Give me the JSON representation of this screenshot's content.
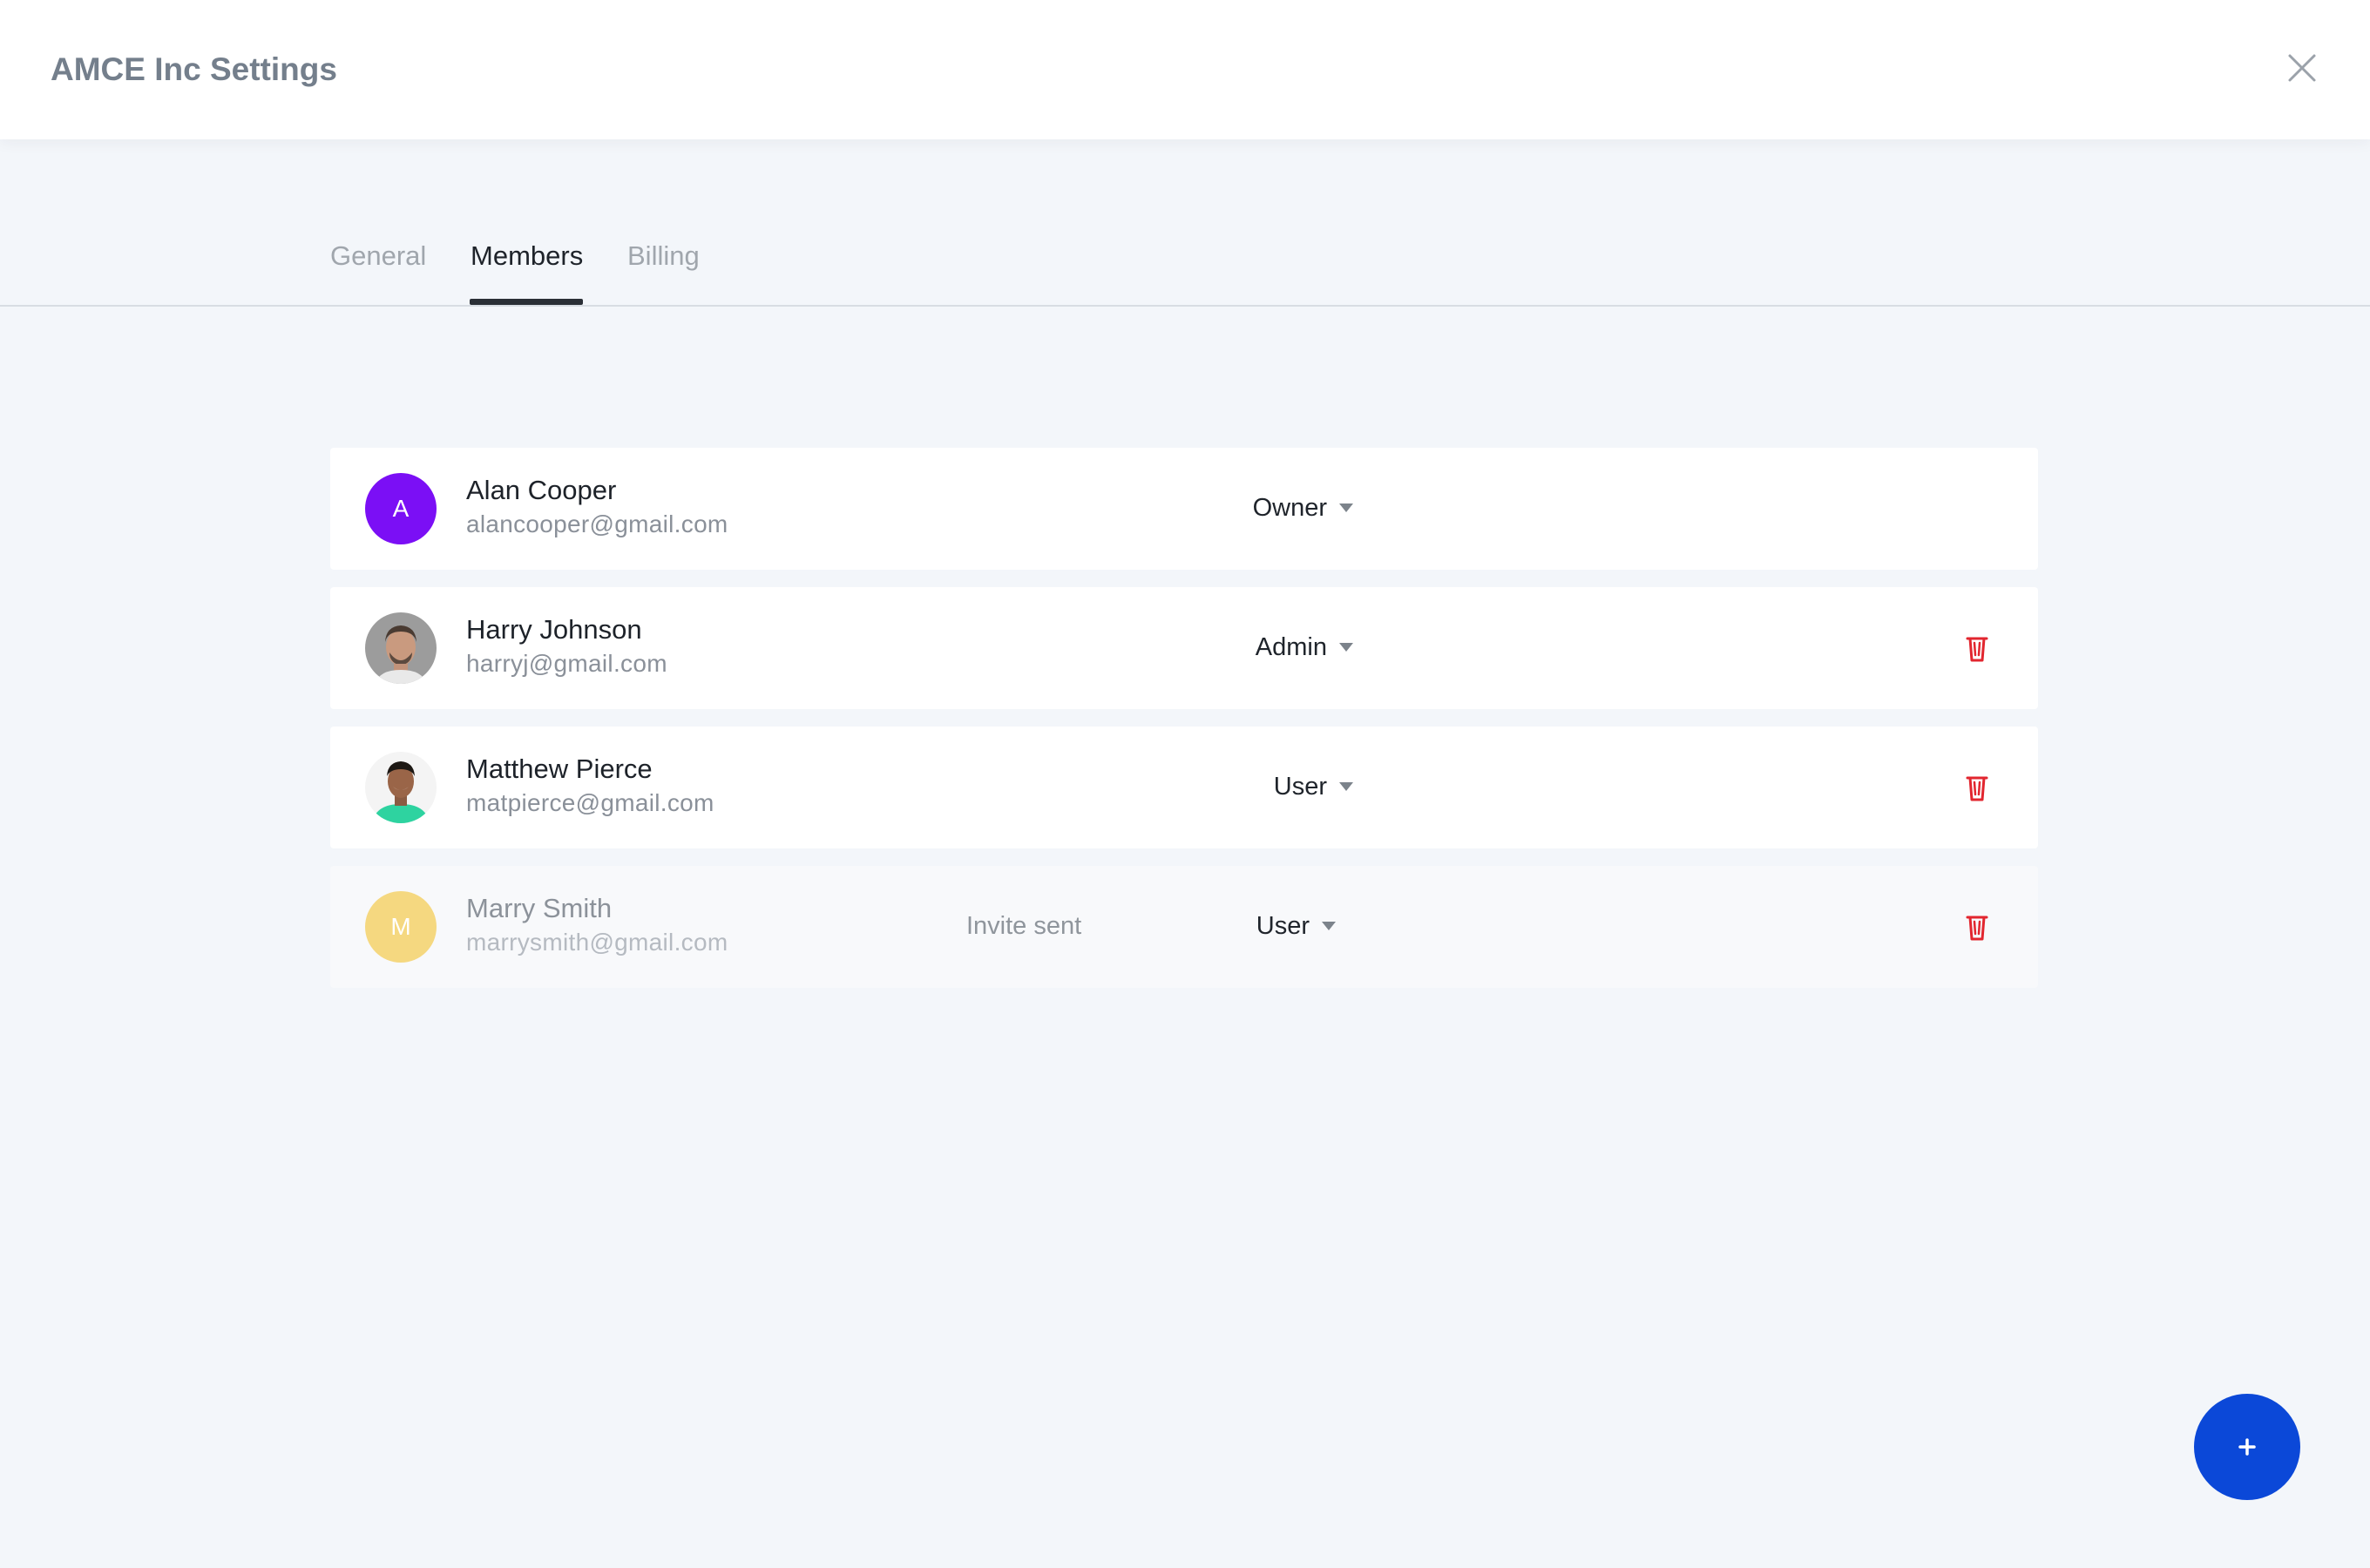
{
  "header": {
    "title": "AMCE Inc Settings",
    "close_icon": "close-icon"
  },
  "tabs": [
    {
      "label": "General",
      "active": false
    },
    {
      "label": "Members",
      "active": true
    },
    {
      "label": "Billing",
      "active": false
    }
  ],
  "members": [
    {
      "name": "Alan Cooper",
      "email": "alancooper@gmail.com",
      "role": "Owner",
      "avatar_type": "initial",
      "avatar_initial": "A",
      "avatar_color": "#7b0ff5",
      "deletable": false,
      "status": ""
    },
    {
      "name": "Harry Johnson",
      "email": "harryj@gmail.com",
      "role": "Admin",
      "avatar_type": "photo",
      "deletable": true,
      "status": ""
    },
    {
      "name": "Matthew Pierce",
      "email": "matpierce@gmail.com",
      "role": "User",
      "avatar_type": "photo",
      "deletable": true,
      "status": ""
    },
    {
      "name": "Marry Smith",
      "email": "marrysmith@gmail.com",
      "role": "User",
      "avatar_type": "initial",
      "avatar_initial": "M",
      "avatar_color": "#f5d880",
      "deletable": true,
      "status": "Invite sent"
    }
  ],
  "fab": {
    "label": "+",
    "icon": "plus-icon",
    "color": "#0b48d8"
  },
  "colors": {
    "delete_icon": "#e2262f",
    "background": "#f3f6fa",
    "active_tab_underline": "#2a2f36"
  }
}
